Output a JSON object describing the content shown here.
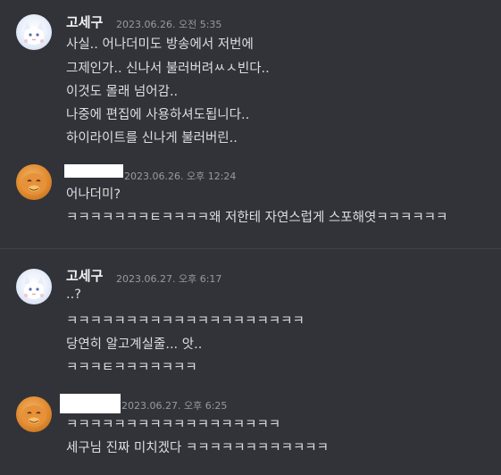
{
  "messages": [
    {
      "username": "고세구",
      "timestamp": "2023.06.26. 오전 5:35",
      "avatar": "white-character-avatar",
      "lines": [
        "사실.. 어나더미도 방송에서 저번에",
        "그제인가.. 신나서 불러버려ㅆㅅ빈다..",
        "이것도 몰래 넘어감..",
        "나중에 편집에 사용하셔도됩니다..",
        "하이라이트를 신나게 불러버린.."
      ]
    },
    {
      "username": "",
      "timestamp": "2023.06.26. 오후 12:24",
      "avatar": "orange-duck-avatar",
      "lines": [
        "어나더미?",
        "ㅋㅋㅋㅋㅋㅋㅋㅌㅋㅋㅋㅋ왜 저한테 자연스럽게 스포해엿ㅋㅋㅋㅋㅋㅋ"
      ]
    },
    {
      "username": "고세구",
      "timestamp": "2023.06.27. 오후 6:17",
      "avatar": "white-character-avatar",
      "lines": [
        "..?",
        "ㅋㅋㅋㅋㅋㅋㅋㅋㅋㅋㅋㅋㅋㅋㅋㅋㅋㅋㅋㅋ",
        "당연히 알고계실줄... 앗..",
        "ㅋㅋㅋㅌㅋㅋㅋㅋㅋㅋㅋ"
      ]
    },
    {
      "username": "",
      "timestamp": "2023.06.27. 오후 6:25",
      "avatar": "orange-duck-avatar",
      "lines": [
        "ㅋㅋㅋㅋㅋㅋㅋㅋㅋㅋㅋㅋㅋㅋㅋㅋㅋㅋ",
        "세구님 진짜 미치겠다 ㅋㅋㅋㅋㅋㅋㅋㅋㅋㅋㅋㅋ"
      ]
    }
  ]
}
